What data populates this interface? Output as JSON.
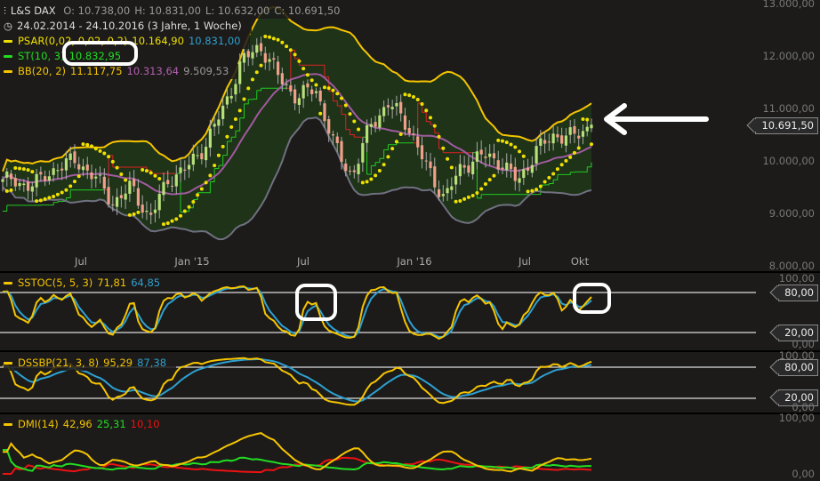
{
  "header": {
    "symbol": "L&S DAX",
    "open": "O: 10.738,00",
    "high": "H: 10.831,00",
    "low": "L: 10.632,00",
    "close": "C: 10.691,50",
    "range": "24.02.2014 - 24.10.2016 (3 Jahre, 1 Woche)"
  },
  "legend": {
    "psar": {
      "label": "PSAR(0,02, 0,02, 0,2)",
      "v1": "10.164,90",
      "v2": "10.831,00"
    },
    "st": {
      "label": "ST(10, 3)",
      "v1": "10.832,95"
    },
    "bb": {
      "label": "BB(20, 2)",
      "v1": "11.117,75",
      "v2": "10.313,64",
      "v3": "9.509,53"
    },
    "sstoc": {
      "label": "SSTOC(5, 5, 3)",
      "v1": "71,81",
      "v2": "64,85"
    },
    "dssbp": {
      "label": "DSSBP(21, 3, 8)",
      "v1": "95,29",
      "v2": "87,38"
    },
    "dmi": {
      "label": "DMI(14)",
      "v1": "42,96",
      "v2": "25,31",
      "v3": "10,10"
    }
  },
  "price_axis": [
    "13.000,00",
    "12.000,00",
    "11.000,00",
    "10.000,00",
    "9.000,00",
    "8.000,00"
  ],
  "last_price": "10.691,50",
  "sstoc_axis": {
    "top": "100,00",
    "hi": "80,00",
    "lo": "20,00",
    "bottom": "0,00"
  },
  "dssbp_axis": {
    "top": "100,00",
    "hi": "80,00",
    "lo": "20,00",
    "bottom": "0,00"
  },
  "dmi_axis": {
    "top": "100,00",
    "bottom": "0,00"
  },
  "x_labels": [
    "Jul",
    "Jan '15",
    "Jul",
    "Jan '16",
    "Jul",
    "Okt"
  ],
  "colors": {
    "bg": "#1c1b1a",
    "up": "#b8e07a",
    "down": "#f0a08a",
    "bb": "#f5c400",
    "bbmid": "#a05aa0",
    "bblow": "#707080",
    "psar": "#f0e000",
    "st_up": "#22cc22",
    "st_down": "#dd2222",
    "fast": "#f5c400",
    "slow": "#2ea0d0",
    "plus": "#22dd22",
    "minus": "#ee1111"
  },
  "monthly_closes": [
    9650,
    9550,
    9600,
    9900,
    10000,
    9700,
    9200,
    9500,
    8900,
    9650,
    9850,
    10300,
    11000,
    11900,
    12200,
    11600,
    11200,
    11400,
    10300,
    9700,
    10700,
    11100,
    10700,
    9900,
    9300,
    9900,
    10100,
    10000,
    9600,
    10200,
    10500,
    10450,
    10691.5
  ]
}
